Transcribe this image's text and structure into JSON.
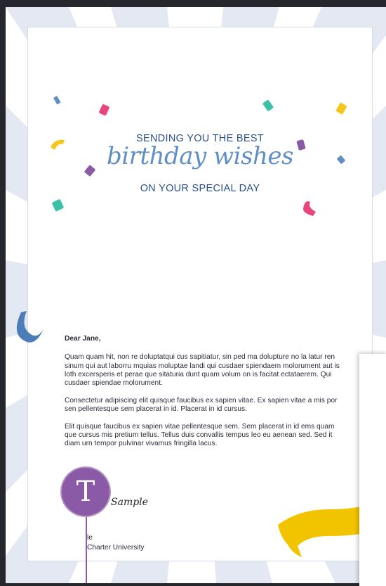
{
  "card": {
    "heading_top": "SENDING YOU THE BEST",
    "heading_script": "birthday wishes",
    "heading_bottom": "ON YOUR SPECIAL DAY"
  },
  "letter": {
    "greeting": "Dear Jane,",
    "paragraphs": [
      "Quam quam hit, non re doluptatqui cus sapitiatur, sin ped ma dolupture no la latur ren sinum qui aut laborru mquias moluptae landi qui cusdaer spiendaem molorument aut is loth excersperis et perae que sitaturia dunt quam volum on is facitat ectataerem. Qui cusdaer spiendae molorument.",
      "Consectetur adipiscing elit quisque faucibus ex sapien vitae. Ex sapien vitae a mis por sen pellentesque sem placerat in id. Placerat in id cursus.",
      "Elit quisque faucibus ex sapien vitae pellentesque sem. Sem placerat in id ems quam que cursus mis pretium tellus. Tellus duis convallis tempus leo eu aenean sed. Sed it diam urn tempor pulvinar vivamus fringilla lacus."
    ],
    "signature": "Sample",
    "signer_name": "le",
    "signer_org": "Charter University"
  },
  "avatar": {
    "initial": "T",
    "color": "#8b5aa6"
  },
  "colors": {
    "background": "#26272d",
    "rays": "#e4e8f2",
    "heading": "#2a4f86",
    "script": "#5f8fc4",
    "ribbon_blue": "#4d7db8",
    "ribbon_yellow": "#f2c400",
    "confetti": [
      "#5f8fc4",
      "#e8457a",
      "#3dbfa8",
      "#f5c518",
      "#8b5aa6"
    ]
  },
  "icons": {
    "avatar": "user-initial-avatar"
  }
}
